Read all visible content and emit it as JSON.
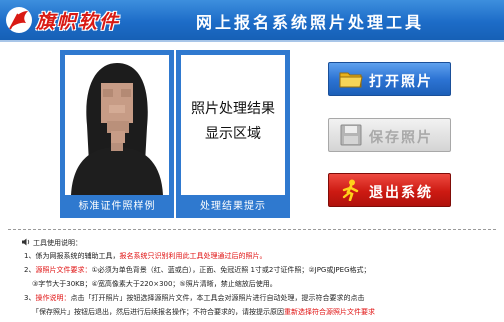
{
  "brand": {
    "name": "旗帜软件"
  },
  "header": {
    "title": "网上报名系统照片处理工具"
  },
  "sample_panel": {
    "caption": "标准证件照样例"
  },
  "result_panel": {
    "line1": "照片处理结果",
    "line2": "显示区域",
    "caption": "处理结果提示"
  },
  "buttons": {
    "open": {
      "label": "打开照片",
      "icon": "folder-icon"
    },
    "save": {
      "label": "保存照片",
      "icon": "floppy-disk-icon"
    },
    "exit": {
      "label": "退出系统",
      "icon": "running-person-icon"
    }
  },
  "instructions": {
    "title": "工具使用说明：",
    "l1_a": "1、係为网报系统的辅助工具，",
    "l1_b": "报名系统只识别利用此工具处理通过后的照片。",
    "l2_a": "2、",
    "l2_b": "源照片文件要求：",
    "l2_c": "①必须为单色背景（红、蓝或白），正面、免冠近照 1寸或2寸证件照；②JPG或JPEG格式；",
    "l3": "③字节大于30KB；④宽高像素大于220×300；⑤照片清晰，禁止缩放后使用。",
    "l4_a": "3、",
    "l4_b": "操作说明：",
    "l4_c": "点击「打开照片」按钮选择源照片文件，本工具会对源照片进行自动处理，提示符合要求的点击",
    "l5_a": "「保存照片」按钮后退出，然后进行后续报名操作；不符合要求的，请按提示原因",
    "l5_b": "重新选择符合源照片文件要求"
  },
  "colors": {
    "header_blue": "#1d6cc8",
    "panel_blue": "#2f79cf",
    "accent_red": "#e01010"
  }
}
